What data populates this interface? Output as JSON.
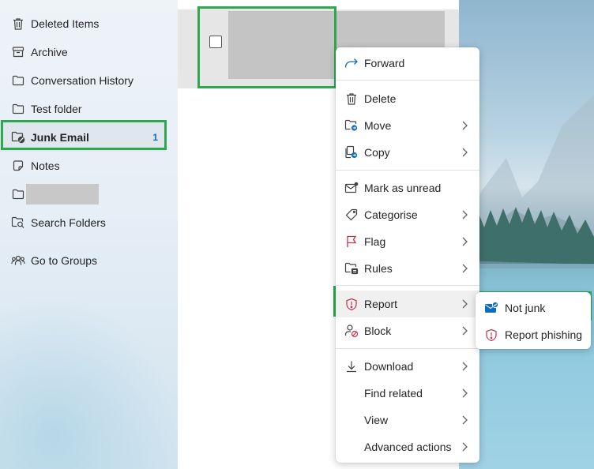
{
  "sidebar": {
    "items": [
      {
        "label": "Deleted Items",
        "icon": "trash-icon"
      },
      {
        "label": "Archive",
        "icon": "archive-icon"
      },
      {
        "label": "Conversation History",
        "icon": "folder-icon"
      },
      {
        "label": "Test folder",
        "icon": "folder-icon"
      },
      {
        "label": "Junk Email",
        "icon": "junk-folder-icon",
        "count": "1",
        "selected": true
      },
      {
        "label": "Notes",
        "icon": "notes-icon"
      },
      {
        "label": "",
        "icon": "folder-icon",
        "redacted": true
      },
      {
        "label": "Search Folders",
        "icon": "search-folder-icon"
      },
      {
        "label": "Go to Groups",
        "icon": "groups-icon"
      }
    ]
  },
  "context_menu": {
    "items": [
      {
        "label": "Forward",
        "icon": "forward-icon",
        "submenu": false
      },
      {
        "label": "Delete",
        "icon": "trash-icon",
        "submenu": false
      },
      {
        "label": "Move",
        "icon": "move-folder-icon",
        "submenu": true
      },
      {
        "label": "Copy",
        "icon": "copy-icon",
        "submenu": true
      },
      {
        "label": "Mark as unread",
        "icon": "mail-unread-icon",
        "submenu": false
      },
      {
        "label": "Categorise",
        "icon": "tag-icon",
        "submenu": true
      },
      {
        "label": "Flag",
        "icon": "flag-icon",
        "submenu": true
      },
      {
        "label": "Rules",
        "icon": "rules-icon",
        "submenu": true
      },
      {
        "label": "Report",
        "icon": "shield-alert-icon",
        "submenu": true,
        "highlighted": true
      },
      {
        "label": "Block",
        "icon": "block-user-icon",
        "submenu": true
      },
      {
        "label": "Download",
        "icon": "download-icon",
        "submenu": true
      },
      {
        "label": "Find related",
        "icon": "",
        "submenu": true
      },
      {
        "label": "View",
        "icon": "",
        "submenu": true
      },
      {
        "label": "Advanced actions",
        "icon": "",
        "submenu": true
      }
    ]
  },
  "report_submenu": {
    "items": [
      {
        "label": "Not junk",
        "icon": "not-junk-icon"
      },
      {
        "label": "Report phishing",
        "icon": "shield-alert-icon"
      }
    ]
  },
  "colors": {
    "accent": "#0f6cbd",
    "highlight_border": "#2ea84f",
    "alert_red": "#c4314b"
  }
}
